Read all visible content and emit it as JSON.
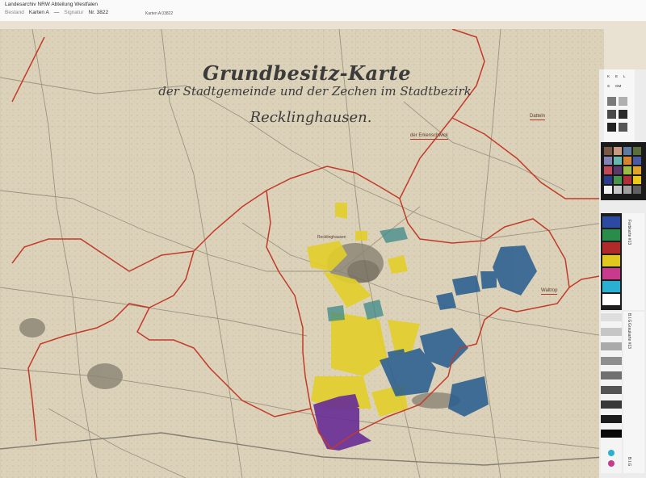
{
  "header": {
    "archive": "Landesarchiv NRW Abteilung Westfalen",
    "bestand_label": "Bestand",
    "bestand_value": "Karten A",
    "separator": "—",
    "signatur_label": "Signatur",
    "signatur_value": "Nr. 3822",
    "small_note": "Karten A 03822"
  },
  "map": {
    "title": "Grundbesitz-Karte",
    "subtitle": "der Stadtgemeinde und der Zechen im Stadtbezirk",
    "city": "Recklinghausen.",
    "places": [
      {
        "name": "Datteln"
      },
      {
        "name": "der Erkenschwick"
      },
      {
        "name": "Waltrop"
      },
      {
        "name": "Recklinghausen"
      }
    ],
    "colors": {
      "paper": "#dcd2b9",
      "boundary": "#c23a2a",
      "yellow": "#e3cf2a",
      "blue": "#2a5f8f",
      "purple": "#6a2f96",
      "teal": "#3c8a8a",
      "roads": "#8c8577"
    }
  },
  "color_card": {
    "lines": [
      "K",
      "E",
      "L",
      "S",
      "GM"
    ],
    "icons": [
      "color-card-icon",
      "grayscale-icon",
      "scale-ruler-icon"
    ]
  },
  "strip": {
    "label_farbkarte": "Farbkarte #13",
    "label_graukarte": "Graukarte #13",
    "tick_a": "B.I.G",
    "tick_b": "B.I.G"
  }
}
